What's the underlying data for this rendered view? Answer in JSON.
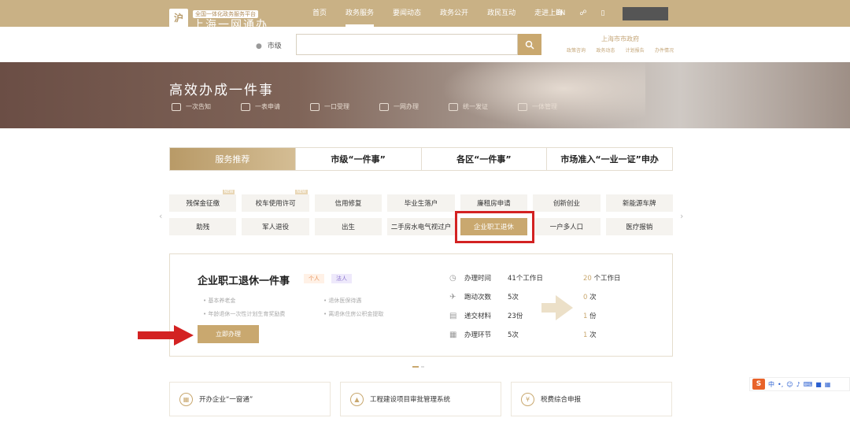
{
  "header": {
    "logo_small": "全国一体化政务服务平台",
    "logo_big": "上海一网通办",
    "nav": [
      "首页",
      "政务服务",
      "要闻动态",
      "政务公开",
      "政民互动",
      "走进上海"
    ],
    "nav_active_index": 1,
    "lang": "EN",
    "accessibility_icon": "accessibility-icon",
    "mobile_icon": "mobile-icon"
  },
  "search": {
    "city": "市级",
    "placeholder": "",
    "button_icon": "search-icon"
  },
  "gov": {
    "title": "上海市市政府",
    "links": [
      "政策咨询",
      "政务动态",
      "计划报告",
      "办件情况"
    ]
  },
  "banner": {
    "title": "高效办成一件事",
    "items": [
      "一次告知",
      "一表申请",
      "一口受理",
      "一网办理",
      "统一发证",
      "一体管理"
    ]
  },
  "tabs": [
    "服务推荐",
    "市级“一件事”",
    "各区“一件事”",
    "市场准入“一业一证”申办"
  ],
  "tab_active_index": 0,
  "chips_row1": [
    {
      "label": "残保金征缴",
      "new": "NEW"
    },
    {
      "label": "校车使用许可",
      "new": "NEW"
    },
    {
      "label": "信用修复",
      "new": ""
    },
    {
      "label": "毕业生落户",
      "new": ""
    },
    {
      "label": "廉租房申请",
      "new": ""
    },
    {
      "label": "创新创业",
      "new": ""
    },
    {
      "label": "新能源车牌",
      "new": ""
    }
  ],
  "chips_row2": [
    "助残",
    "军人退役",
    "出生",
    "二手房水电气视过户",
    "企业职工退休",
    "一户多人口",
    "医疗报销"
  ],
  "chip_selected": "企业职工退休",
  "detail": {
    "title": "企业职工退休一件事",
    "tag_personal": "个人",
    "tag_legal": "法人",
    "features": [
      "基本养老金",
      "退休医保待遇",
      "年龄退休一次性计划生育奖励费",
      "离退休住房公积金提取"
    ],
    "button": "立即办理",
    "stats": [
      {
        "icon": "clock-icon",
        "label": "办理时间",
        "old": "41个工作日",
        "new_num": "20",
        "new_unit": " 个工作日"
      },
      {
        "icon": "run-icon",
        "label": "跑动次数",
        "old": "5次",
        "new_num": "0",
        "new_unit": " 次"
      },
      {
        "icon": "document-icon",
        "label": "递交材料",
        "old": "23份",
        "new_num": "1",
        "new_unit": " 份"
      },
      {
        "icon": "step-icon",
        "label": "办理环节",
        "old": "5次",
        "new_num": "1",
        "new_unit": " 次"
      }
    ]
  },
  "cards": [
    {
      "label": "开办企业“一窗通”",
      "icon": "building-icon"
    },
    {
      "label": "工程建设项目审批管理系统",
      "icon": "construction-icon"
    },
    {
      "label": "税费综合申报",
      "icon": "tax-icon"
    }
  ],
  "ime": {
    "label": "中"
  }
}
